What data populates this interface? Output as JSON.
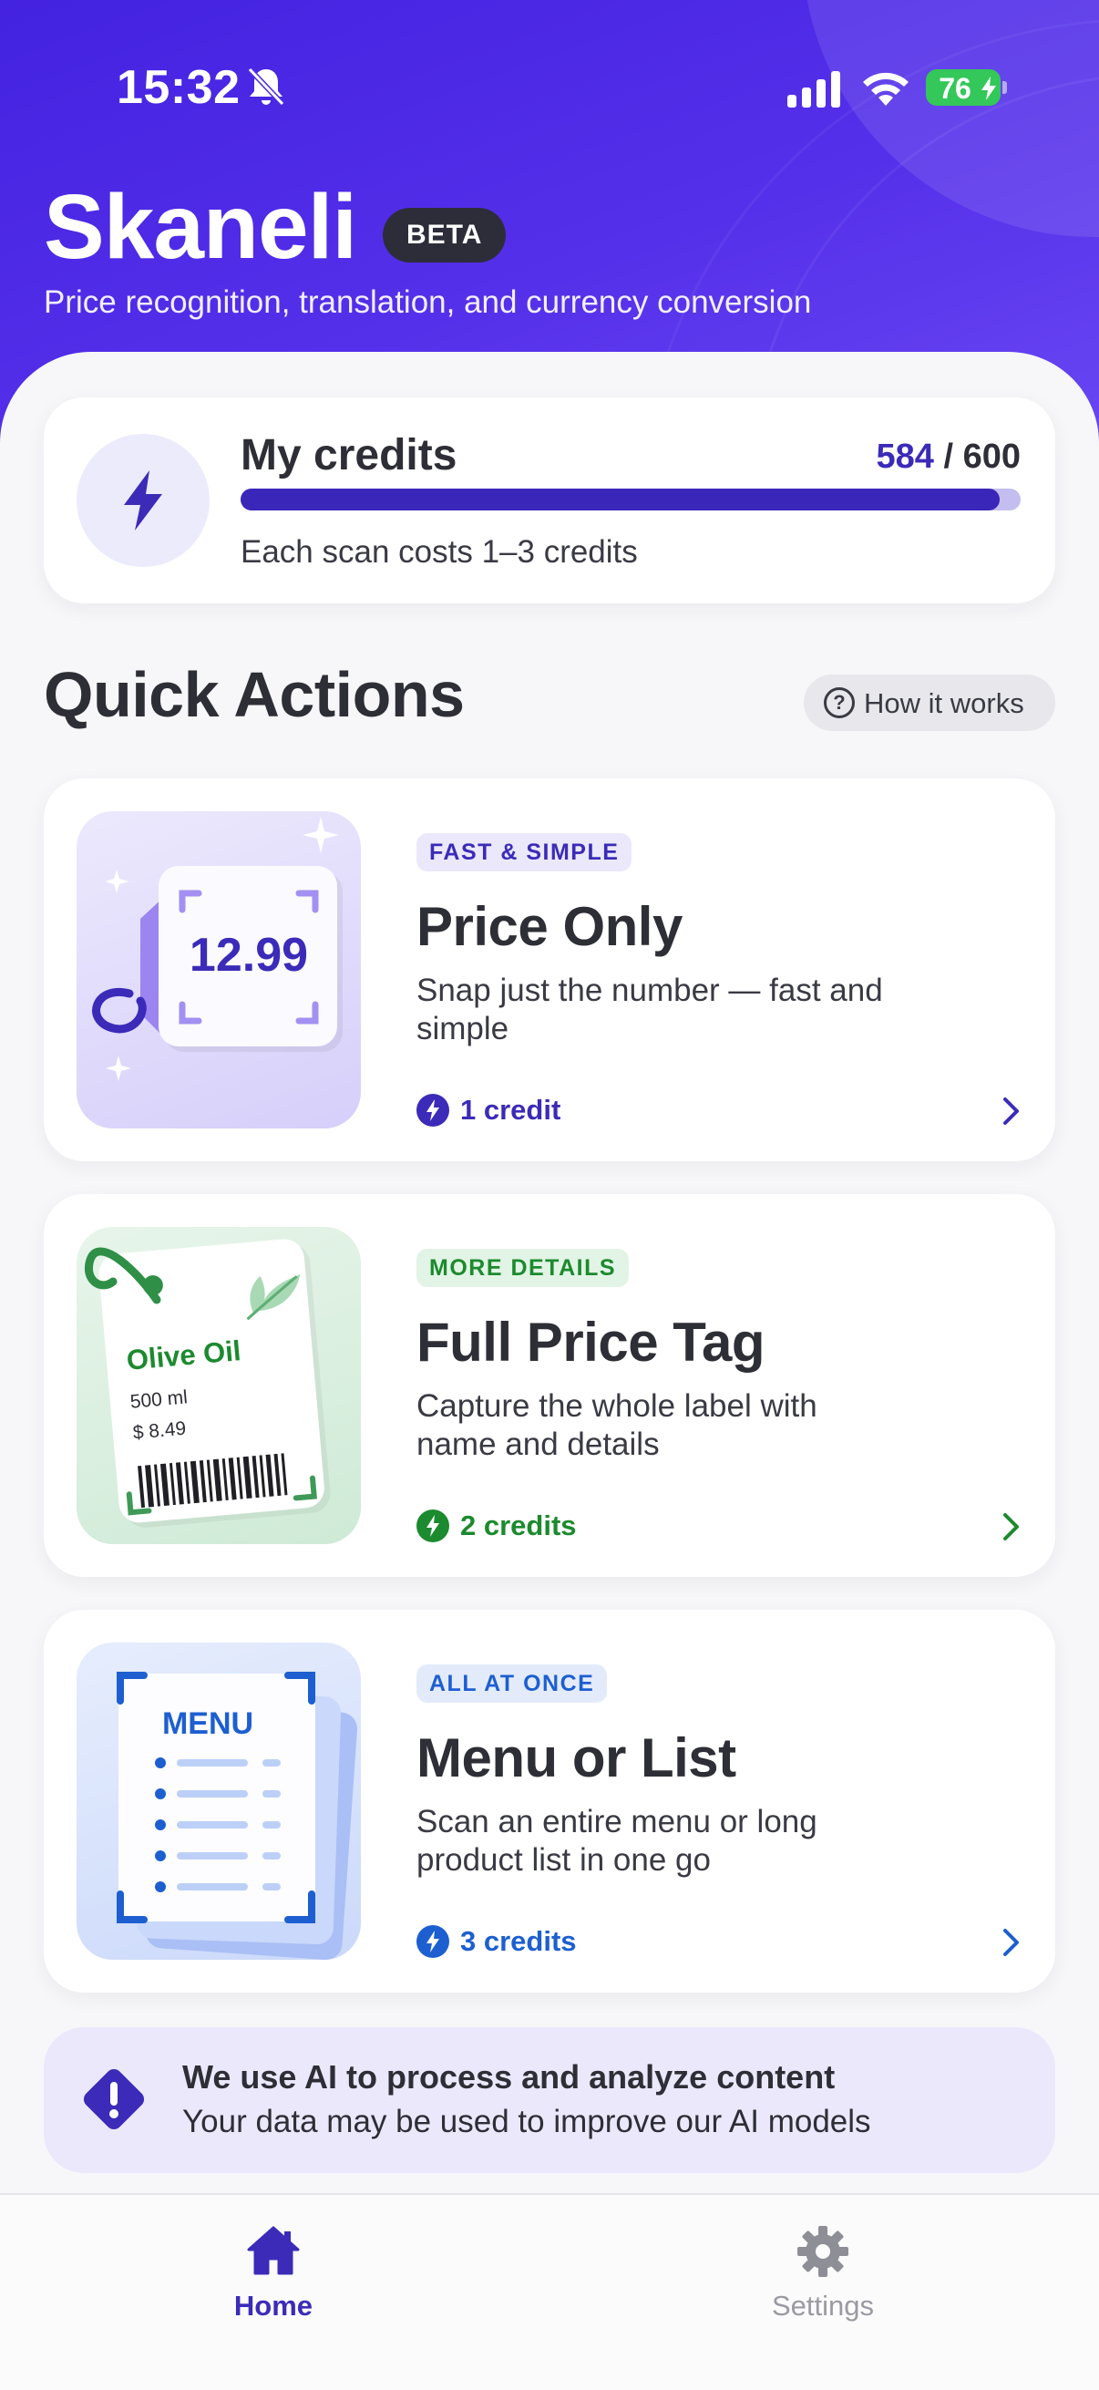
{
  "status_bar": {
    "time": "15:32",
    "battery": "76"
  },
  "header": {
    "app_name": "Skaneli",
    "badge": "BETA",
    "subtitle": "Price recognition, translation, and currency conversion"
  },
  "credits": {
    "label": "My credits",
    "used": "584",
    "separator": " / ",
    "total": "600",
    "fraction_remaining": 0.973,
    "note": "Each scan costs 1–3 credits"
  },
  "quick_actions": {
    "title": "Quick Actions",
    "how_it_works": "How it works",
    "items": [
      {
        "tag": "FAST & SIMPLE",
        "title": "Price Only",
        "description": "Snap just the number — fast and simple",
        "cost": "1 credit",
        "illustration_text": "12.99",
        "accent": "#3b2bb8"
      },
      {
        "tag": "MORE DETAILS",
        "title": "Full Price Tag",
        "description": "Capture the whole label with name and details",
        "cost": "2 credits",
        "illustration_text": {
          "product": "Olive Oil",
          "volume": "500 ml",
          "price": "$ 8.49"
        },
        "accent": "#1c8a2e"
      },
      {
        "tag": "ALL AT ONCE",
        "title": "Menu or List",
        "description": "Scan an entire menu or long product list in one go",
        "cost": "3 credits",
        "illustration_text": "MENU",
        "accent": "#1d5fd0"
      }
    ]
  },
  "notice": {
    "title": "We use AI to process and analyze content",
    "body": "Your data may be used to improve our AI models"
  },
  "tab_bar": {
    "tabs": [
      {
        "label": "Home",
        "icon": "home-icon",
        "active": true
      },
      {
        "label": "Settings",
        "icon": "gear-icon",
        "active": false
      }
    ]
  },
  "colors": {
    "brand": "#4a28e6",
    "primary": "#3b2bb8",
    "green": "#1c8a2e",
    "blue": "#1d5fd0",
    "battery": "#34c759"
  }
}
